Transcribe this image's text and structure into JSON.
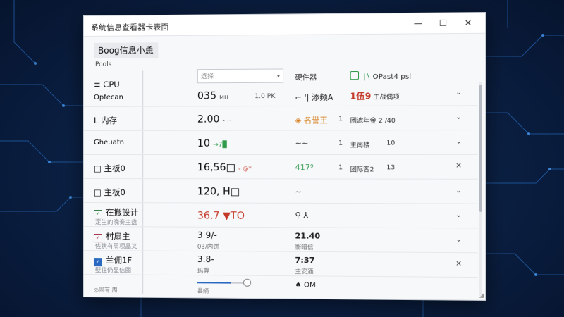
{
  "window": {
    "title": "系统信息查看器卡表面",
    "controls": [
      "—",
      "☐",
      "✕"
    ]
  },
  "app": {
    "title": "Boog信息小恿",
    "sub_label": "Pools"
  },
  "header": {
    "select_placeholder": "选择",
    "col_hardware": "硬件器",
    "col_info": "OPast4 psl"
  },
  "sidebar": {
    "items": [
      {
        "label": "≡ CPU",
        "sub": ""
      },
      {
        "label": "Opfecan",
        "sub": ""
      },
      {
        "label": "L 内存",
        "sub": ""
      },
      {
        "label": "Gheuatn",
        "sub": ""
      },
      {
        "label": "□ 主板0",
        "sub": ""
      },
      {
        "label": "□ 主板0",
        "sub": ""
      },
      {
        "label": "在搬設计",
        "sub": "定生的晚奏主盘",
        "check": "✓"
      },
      {
        "label": "村扇主",
        "sub": "佐状有周项晶叉",
        "check": "✓"
      },
      {
        "label": "兰佣1F",
        "sub": "壁住仍显信图",
        "check": "✓"
      }
    ],
    "bottom": "◎固有 周"
  },
  "rows": [
    {
      "value": "035",
      "unit": "мн",
      "mid": "1.0 PK",
      "hw": "⌐ '| 添频A",
      "n": "",
      "info": "1伍9",
      "info_extra": "主战偶项",
      "num": "",
      "chevron": "⌄"
    },
    {
      "value": "2.00",
      "unit": "- ~",
      "mid": "",
      "hw": "◈ 名誉王",
      "n": "1",
      "info": "团滤年金 2 /40",
      "info_extra": "",
      "num": "",
      "chevron": "⌄"
    },
    {
      "value": "10",
      "unit": "→7▉",
      "mid": "",
      "hw": "~~",
      "n": "1",
      "info": "主南楼",
      "info_extra": "",
      "num": "10",
      "chevron": "⌄"
    },
    {
      "value": "16,56□",
      "unit": "- ◎*",
      "mid": "",
      "hw": "417⁹",
      "n": "1",
      "info": "团际客2",
      "info_extra": "",
      "num": "13",
      "chevron": "✕"
    },
    {
      "value": "120, H□",
      "unit": "",
      "mid": "",
      "hw": "~",
      "n": "",
      "info": "",
      "info_extra": "",
      "num": "",
      "chevron": "⌄"
    },
    {
      "value": "36.7 ▼TO",
      "unit": "",
      "mid": "",
      "hw": "⚲ ⅄",
      "n": "",
      "info": "",
      "info_extra": "",
      "num": "",
      "chevron": "⌄"
    },
    {
      "value": "3 9/-",
      "sub": "03/内饼",
      "unit": "",
      "mid": "",
      "hw": "21.40",
      "hwsub": "衡暗信",
      "n": "",
      "info": "",
      "info_extra": "",
      "num": "",
      "chevron": "⌄"
    },
    {
      "value": "3.8-",
      "sub": "玛弊",
      "unit": "",
      "mid": "",
      "hw": "7:37",
      "hwsub": "主安通",
      "n": "",
      "info": "",
      "info_extra": "",
      "num": "",
      "chevron": "✕"
    }
  ],
  "footer": {
    "slider_label": "县嫡",
    "slider_fraction": 0.65,
    "om_label": "♠ OM"
  },
  "colors": {
    "accent_green": "#2e9a4a",
    "accent_red": "#c43a2a",
    "accent_blue": "#2a69c2",
    "background": "#0b2146"
  }
}
